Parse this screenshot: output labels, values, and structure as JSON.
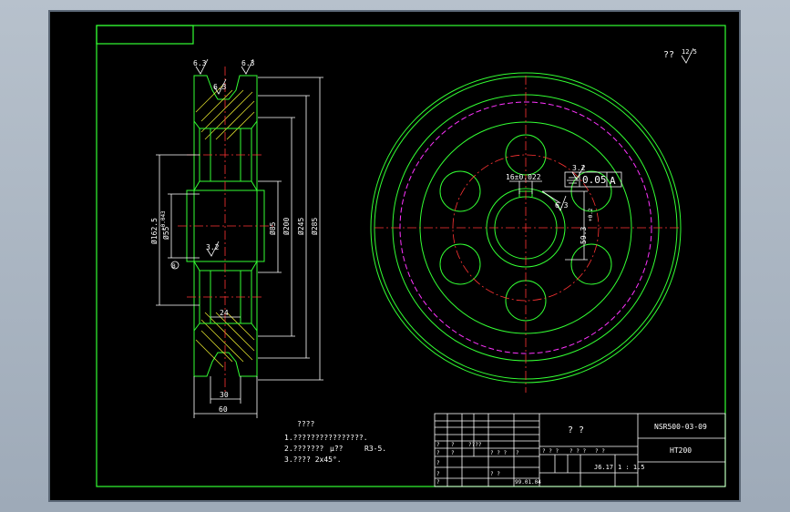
{
  "drawing": {
    "part_no": "NSR500-03-09",
    "material": "HT200",
    "title": "? ?",
    "scale_ratio": "1 : 1.5",
    "scale_code": "J6.17",
    "date_cell": "99.01.04",
    "roughness_rest_label": "??",
    "roughness_rest_value": "12.5"
  },
  "notes": {
    "heading": "????",
    "line1": "1.????????????????.",
    "line2": "2.??????? ",
    "line2b": "μ̃??",
    "line2c": "R3-5.",
    "line3": "3.???? 2x45°."
  },
  "dims": {
    "d285": "Ø285",
    "d245": "Ø245",
    "d200": "Ø200",
    "d85": "Ø85",
    "d162": "Ø162.5",
    "d55": "Ø55",
    "d55tol": "+0.043",
    "w24": "24",
    "w30": "30",
    "w60": "60",
    "key": "16±0.022",
    "depth": "59.3",
    "depthtol": "+0.2",
    "tol_value": "0.05",
    "datum": "A",
    "datum_b": "B",
    "r63": "6.3",
    "r32": "3.2"
  },
  "title_block": {
    "cells": [
      "?",
      "?",
      "????",
      "?",
      "?",
      "? ? ?",
      "?",
      "? ? ?",
      "? ? ?",
      "? ?",
      "?",
      "?",
      "? ?",
      "?"
    ]
  }
}
